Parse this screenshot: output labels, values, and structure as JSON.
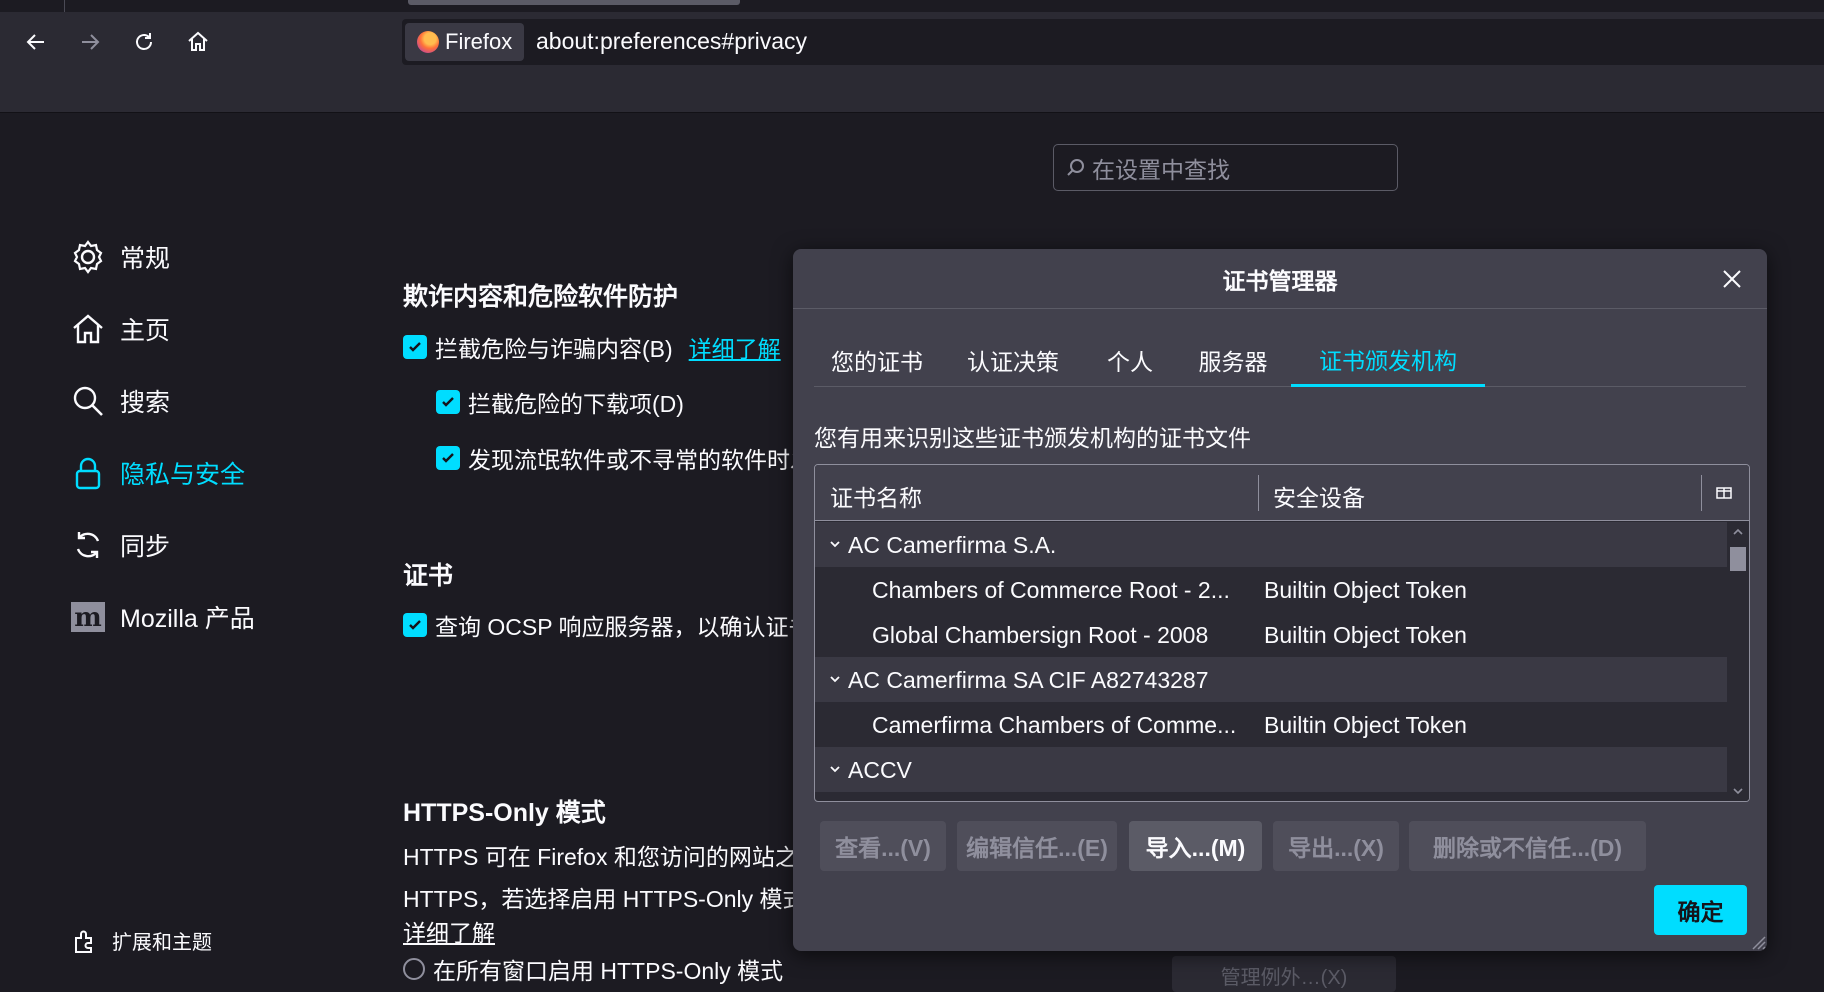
{
  "browser": {
    "identity_label": "Firefox",
    "url": "about:preferences#privacy",
    "icons": [
      "back-icon",
      "forward-icon",
      "reload-icon",
      "home-icon"
    ]
  },
  "prefs": {
    "search_placeholder": "在设置中查找",
    "sidebar": {
      "items": [
        {
          "label": "常规",
          "icon": "gear-icon"
        },
        {
          "label": "主页",
          "icon": "home-icon"
        },
        {
          "label": "搜索",
          "icon": "search-icon"
        },
        {
          "label": "隐私与安全",
          "icon": "lock-icon",
          "active": true
        },
        {
          "label": "同步",
          "icon": "sync-icon"
        },
        {
          "label": "Mozilla 产品",
          "icon": "mozilla-icon"
        }
      ],
      "extensions_label": "扩展和主题"
    },
    "phishing": {
      "heading": "欺诈内容和危险软件防护",
      "block_dangerous": "拦截危险与诈骗内容(B)",
      "learn_more": "详细了解",
      "block_downloads": "拦截危险的下载项(D)",
      "warn_unwanted": "发现流氓软件或不寻常的软件时发出警告(C)"
    },
    "certs": {
      "heading": "证书",
      "ocsp": "查询 OCSP 响应服务器，以确认证书的当前有效性(Q)"
    },
    "https_only": {
      "heading": "HTTPS-Only 模式",
      "line1": "HTTPS 可在 Firefox 和您访问的网站之间提供安全的加密连接。大多数网站都支持",
      "line2": "HTTPS，若选择启用 HTTPS-Only 模式，Firefox 会将所有连接升级为 HTTPS。",
      "learn_more": "详细了解",
      "radio_all": "在所有窗口启用 HTTPS-Only 模式",
      "manage_exceptions": "管理例外…(X)"
    }
  },
  "dialog": {
    "title": "证书管理器",
    "tabs": [
      "您的证书",
      "认证决策",
      "个人",
      "服务器",
      "证书颁发机构"
    ],
    "selected_tab": 4,
    "description": "您有用来识别这些证书颁发机构的证书文件",
    "columns": [
      "证书名称",
      "安全设备"
    ],
    "rows": [
      {
        "type": "group",
        "name": "AC Camerfirma S.A."
      },
      {
        "type": "child",
        "name": "Chambers of Commerce Root - 2...",
        "device": "Builtin Object Token"
      },
      {
        "type": "child",
        "name": "Global Chambersign Root - 2008",
        "device": "Builtin Object Token"
      },
      {
        "type": "group",
        "name": "AC Camerfirma SA CIF A82743287"
      },
      {
        "type": "child",
        "name": "Camerfirma Chambers of Comme...",
        "device": "Builtin Object Token"
      },
      {
        "type": "group",
        "name": "ACCV"
      }
    ],
    "buttons": {
      "view": "查看...(V)",
      "edit_trust": "编辑信任...(E)",
      "import": "导入...(M)",
      "export": "导出...(X)",
      "delete_distrust": "删除或不信任...(D)",
      "ok": "确定"
    }
  }
}
